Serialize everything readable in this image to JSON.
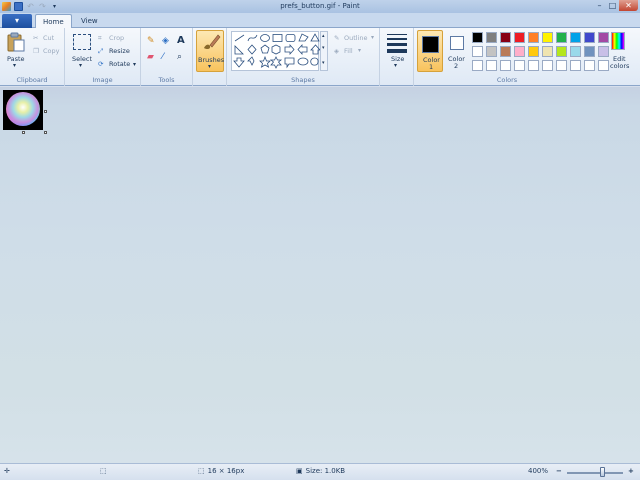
{
  "window": {
    "title": "prefs_button.gif - Paint",
    "controls": {
      "minimize": "–",
      "maximize": "□",
      "close": "✕"
    }
  },
  "quick_access": [
    "paint-app-icon",
    "save-icon",
    "undo-icon",
    "redo-icon",
    "customize-dropdown-icon"
  ],
  "tabs": {
    "app_menu": "▾",
    "items": [
      {
        "label": "Home",
        "active": true
      },
      {
        "label": "View",
        "active": false
      }
    ]
  },
  "ribbon": {
    "clipboard": {
      "label": "Clipboard",
      "paste": "Paste",
      "cut": "Cut",
      "copy": "Copy"
    },
    "image": {
      "label": "Image",
      "select": "Select",
      "crop": "Crop",
      "resize": "Resize",
      "rotate": "Rotate"
    },
    "tools": {
      "label": "Tools"
    },
    "brushes": {
      "label": "Brushes"
    },
    "shapes": {
      "label": "Shapes",
      "outline": "Outline",
      "fill": "Fill"
    },
    "size": {
      "label": "Size"
    },
    "colors": {
      "label": "Colors",
      "color1_line1": "Color",
      "color1_line2": "1",
      "color2_line1": "Color",
      "color2_line2": "2",
      "edit_line1": "Edit",
      "edit_line2": "colors",
      "color1_value": "#000000",
      "color2_value": "#ffffff",
      "palette_row1": [
        "#000000",
        "#7f7f7f",
        "#880015",
        "#ed1c24",
        "#ff7f27",
        "#fff200",
        "#22b14c",
        "#00a2e8",
        "#3f48cc",
        "#a349a4"
      ],
      "palette_row2": [
        "#ffffff",
        "#c3c3c3",
        "#b97a57",
        "#ffaec9",
        "#ffc90e",
        "#efe4b0",
        "#b5e61d",
        "#99d9ea",
        "#7092be",
        "#c8bfe7"
      ],
      "palette_row3": [
        "#ffffff",
        "#ffffff",
        "#ffffff",
        "#ffffff",
        "#ffffff",
        "#ffffff",
        "#ffffff",
        "#ffffff",
        "#ffffff",
        "#ffffff"
      ]
    }
  },
  "status": {
    "dimensions": "16 × 16px",
    "size": "Size: 1.0KB",
    "zoom": "400%"
  }
}
